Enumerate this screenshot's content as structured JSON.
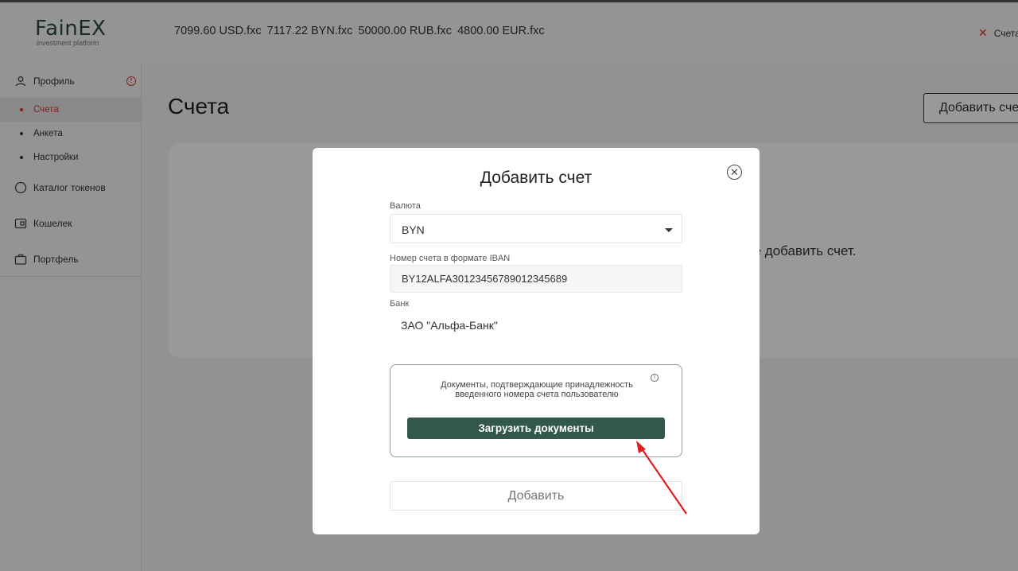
{
  "header": {
    "logo_title": "FainEX",
    "logo_subtitle": "investment platform",
    "balances": [
      "7099.60 USD.fxc",
      "7117.22 BYN.fxc",
      "50000.00 RUB.fxc",
      "4800.00 EUR.fxc"
    ],
    "right_label": "Счета"
  },
  "sidebar": {
    "profile": "Профиль",
    "sub_items": [
      "Счета",
      "Анкета",
      "Настройки"
    ],
    "active_sub": "Счета",
    "catalog": "Каталог токенов",
    "wallet": "Кошелек",
    "portfolio": "Портфель"
  },
  "main": {
    "title": "Счета",
    "add_button": "Добавить счет",
    "empty_text": "те добавить счет."
  },
  "modal": {
    "title": "Добавить счет",
    "close_icon": "close-circle-icon",
    "currency_label": "Валюта",
    "currency_value": "BYN",
    "iban_label": "Номер счета в формате IBAN",
    "iban_value": "BY12ALFA30123456789012345689",
    "bank_label": "Банк",
    "bank_value": "ЗАО \"Альфа-Банк\"",
    "docs_text": "Документы, подтверждающие принадлежность введенного номера счета пользователю",
    "upload_button": "Загрузить документы",
    "submit_button": "Добавить"
  },
  "colors": {
    "accent": "#32584a",
    "active_red": "#dd3333",
    "annotation_arrow": "#e02020"
  }
}
